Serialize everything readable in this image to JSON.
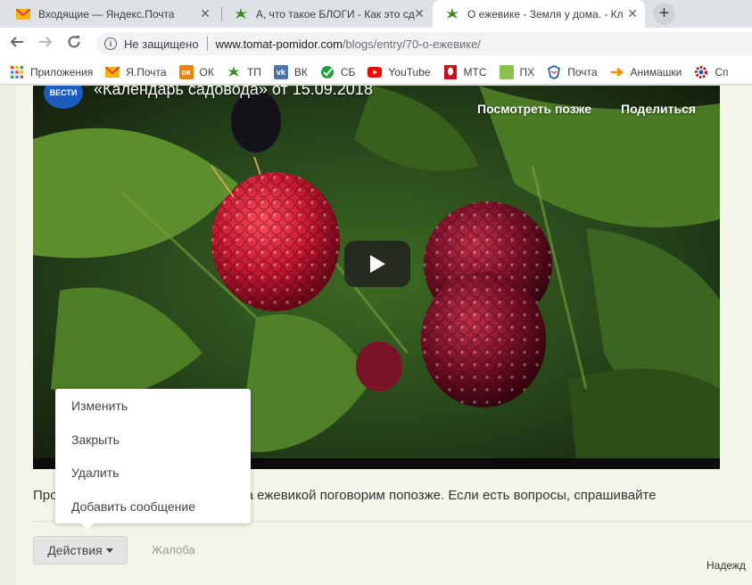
{
  "tabs": [
    {
      "title": "Входящие — Яндекс.Почта",
      "favicon": "yandex-mail-icon",
      "color": "#e8453c"
    },
    {
      "title": "А, что такое БЛОГИ - Как это сд",
      "favicon": "tomato-leaf-icon",
      "color": "#3a8a24"
    },
    {
      "title": "О ежевике - Земля у дома. - Кл",
      "favicon": "tomato-leaf-icon",
      "color": "#3a8a24"
    }
  ],
  "toolbar": {
    "security": "Не защищено",
    "url_host": "www.tomat-pomidor.com",
    "url_path": "/blogs/entry/70-о-ежевике/"
  },
  "bookmarks": [
    {
      "label": "Приложения",
      "icon": "apps-grid-icon",
      "color": "#e8453c"
    },
    {
      "label": "Я.Почта",
      "icon": "yandex-mail-icon",
      "color": "#f4b400"
    },
    {
      "label": "ОК",
      "icon": "odnoklassniki-icon",
      "color": "#ee8208"
    },
    {
      "label": "ТП",
      "icon": "tomato-leaf-icon",
      "color": "#3a8a24"
    },
    {
      "label": "ВК",
      "icon": "vk-icon",
      "color": "#4a76a8"
    },
    {
      "label": "СБ",
      "icon": "sberbank-icon",
      "color": "#21a038"
    },
    {
      "label": "YouTube",
      "icon": "youtube-icon",
      "color": "#ff0000"
    },
    {
      "label": "МТС",
      "icon": "mts-icon",
      "color": "#c4141b"
    },
    {
      "label": "ПХ",
      "icon": "square-icon",
      "color": "#8bc34a"
    },
    {
      "label": "Почта",
      "icon": "russian-post-icon",
      "color": "#1a5fb4"
    },
    {
      "label": "Анимашки",
      "icon": "arrow-icon",
      "color": "#f08c00"
    },
    {
      "label": "Сп",
      "icon": "cog-icon",
      "color": "#b71c1c"
    }
  ],
  "video": {
    "channel": "ВЕСТИ",
    "title": "«Календарь садовода» от 15.09.2018",
    "watch_later": "Посмотреть позже",
    "share": "Поделиться"
  },
  "post": {
    "text": "Про                                          ода за ежевикой поговорим попозже. Если есть вопросы, спрашивайте",
    "author": "Надежд"
  },
  "menu": {
    "items": [
      "Изменить",
      "Закрыть",
      "Удалить",
      "Добавить сообщение"
    ]
  },
  "actions": {
    "button": "Действия",
    "complaint": "Жалоба"
  }
}
